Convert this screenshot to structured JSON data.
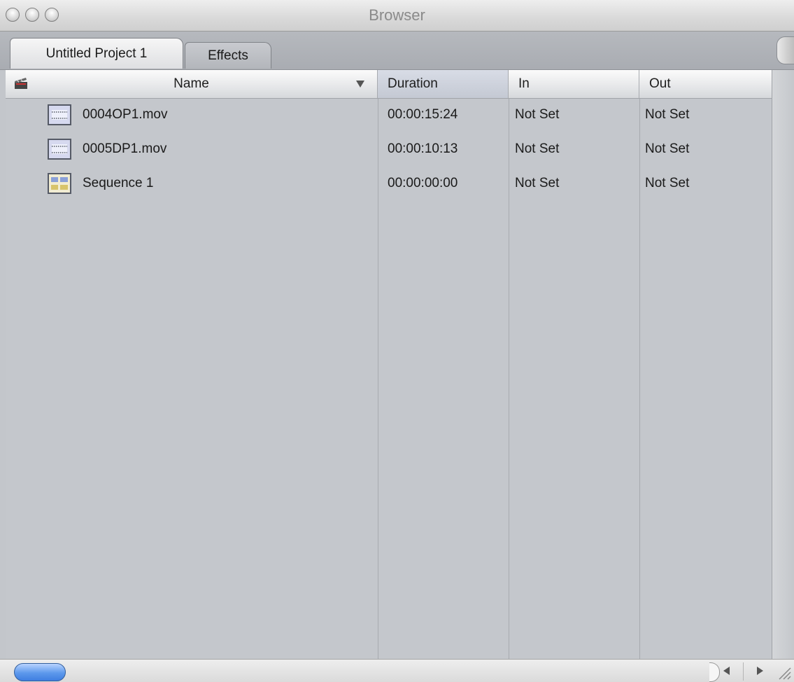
{
  "window": {
    "title": "Browser"
  },
  "tabs": [
    {
      "label": "Untitled Project 1",
      "active": true
    },
    {
      "label": "Effects",
      "active": false
    }
  ],
  "columns": {
    "name": "Name",
    "duration": "Duration",
    "in": "In",
    "out": "Out"
  },
  "rows": [
    {
      "icon": "clip-icon",
      "name": "0004OP1.mov",
      "duration": "00:00:15:24",
      "in": "Not Set",
      "out": "Not Set"
    },
    {
      "icon": "clip-icon",
      "name": "0005DP1.mov",
      "duration": "00:00:10:13",
      "in": "Not Set",
      "out": "Not Set"
    },
    {
      "icon": "sequence-icon",
      "name": "Sequence 1",
      "duration": "00:00:00:00",
      "in": "Not Set",
      "out": "Not Set"
    }
  ],
  "colors": {
    "scroll_thumb": "#5c98ec",
    "list_background": "#c4c7cc",
    "sorted_column": "#c4c9d3"
  }
}
